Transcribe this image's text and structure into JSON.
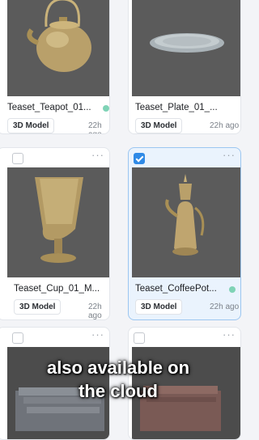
{
  "assets": [
    {
      "name": "Teaset_Teapot_01...",
      "type": "3D Model",
      "time": "22h ago",
      "selected": false,
      "model": "teapot-model"
    },
    {
      "name": "Teaset_Plate_01_...",
      "type": "3D Model",
      "time": "22h ago",
      "selected": false,
      "model": "plate-model"
    },
    {
      "name": "Teaset_Cup_01_M...",
      "type": "3D Model",
      "time": "22h ago",
      "selected": false,
      "model": "cup-model"
    },
    {
      "name": "Teaset_CoffeePot...",
      "type": "3D Model",
      "time": "22h ago",
      "selected": true,
      "model": "coffeepot-model"
    },
    {
      "name": "",
      "type": "",
      "time": "",
      "selected": false,
      "model": "stack-model"
    },
    {
      "name": "",
      "type": "",
      "time": "",
      "selected": false,
      "model": "box-model"
    }
  ],
  "caption": {
    "line1": "also available on",
    "line2": "the cloud"
  },
  "colors": {
    "accent": "#2f8ae6",
    "status_dot": "#7fd3b6",
    "selected_bg": "#eaf3fd"
  },
  "icons": {
    "more": "more-icon",
    "checkbox": "checkbox-icon"
  }
}
